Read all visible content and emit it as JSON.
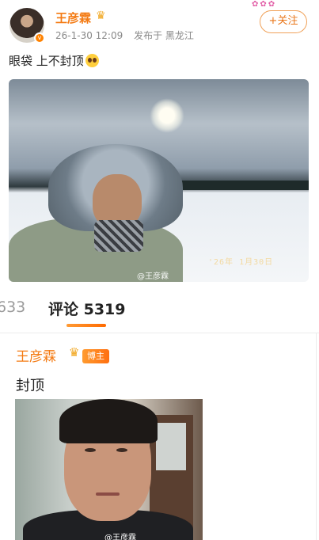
{
  "post": {
    "username": "王彦霖",
    "crown": "♛",
    "verified_badge": "v",
    "date": "26-1-30 12:09",
    "location": "发布于 黑龙江",
    "follow_label": "+关注",
    "text": "眼袋 上不封顶",
    "image": {
      "watermark": "@王彦霖",
      "date_stamp": "'26年 1月30日"
    }
  },
  "tabs": {
    "reposts_partial": "633",
    "comments": "评论 5319"
  },
  "comment": {
    "author": "王彦霖",
    "crown": "♛",
    "badge": "博主",
    "text": "封顶",
    "image": {
      "watermark": "@王彦霖"
    }
  },
  "colors": {
    "accent_orange": "#f47a12",
    "tab_underline": "#ff7a10",
    "follow_border": "#f0a25a"
  },
  "icons": [
    "crown-icon",
    "verified-badge-icon",
    "emoji-icon"
  ]
}
